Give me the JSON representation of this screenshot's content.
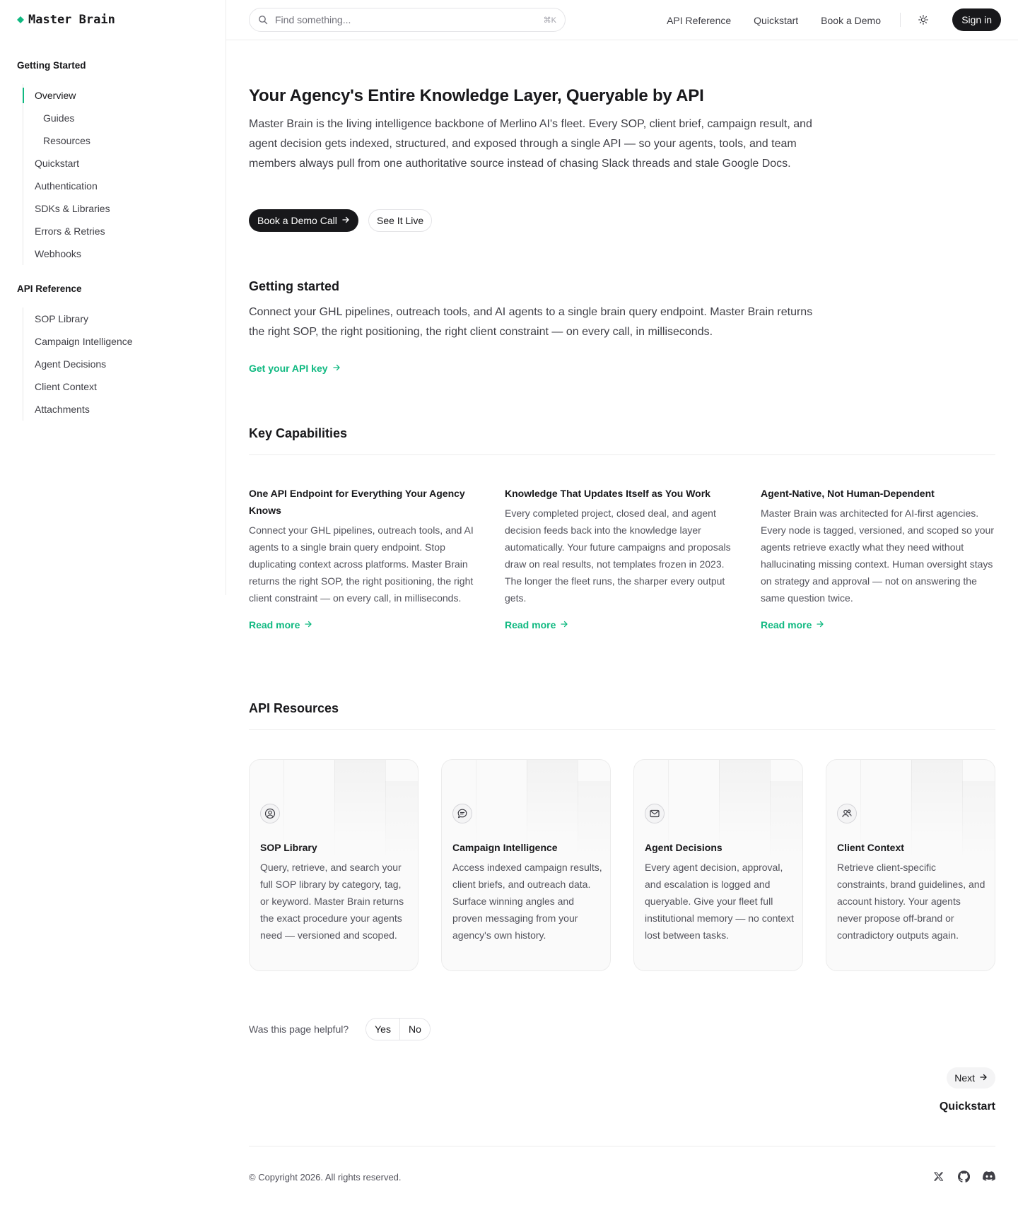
{
  "brand": {
    "name": "Master Brain",
    "accent": "#10b981"
  },
  "sidebar": {
    "groups": [
      {
        "title": "Getting Started",
        "items": [
          {
            "label": "Overview",
            "active": true
          },
          {
            "label": "Guides",
            "sub": true
          },
          {
            "label": "Resources",
            "sub": true
          },
          {
            "label": "Quickstart"
          },
          {
            "label": "Authentication"
          },
          {
            "label": "SDKs & Libraries"
          },
          {
            "label": "Errors & Retries"
          },
          {
            "label": "Webhooks"
          }
        ]
      },
      {
        "title": "API Reference",
        "items": [
          {
            "label": "SOP Library"
          },
          {
            "label": "Campaign Intelligence"
          },
          {
            "label": "Agent Decisions"
          },
          {
            "label": "Client Context"
          },
          {
            "label": "Attachments"
          }
        ]
      }
    ]
  },
  "header": {
    "search_placeholder": "Find something...",
    "search_shortcut": "⌘K",
    "links": [
      "API Reference",
      "Quickstart",
      "Book a Demo"
    ],
    "sign_in": "Sign in"
  },
  "hero": {
    "title": "Your Agency's Entire Knowledge Layer, Queryable by API",
    "description": "Master Brain is the living intelligence backbone of Merlino AI's fleet. Every SOP, client brief, campaign result, and agent decision gets indexed, structured, and exposed through a single API — so your agents, tools, and team members always pull from one authoritative source instead of chasing Slack threads and stale Google Docs.",
    "primary_cta": "Book a Demo Call",
    "secondary_cta": "See It Live"
  },
  "getting_started": {
    "heading": "Getting started",
    "description": "Connect your GHL pipelines, outreach tools, and AI agents to a single brain query endpoint. Master Brain returns the right SOP, the right positioning, the right client constraint — on every call, in milliseconds.",
    "link": "Get your API key"
  },
  "capabilities": {
    "heading": "Key Capabilities",
    "items": [
      {
        "title": "One API Endpoint for Everything Your Agency Knows",
        "body": "Connect your GHL pipelines, outreach tools, and AI agents to a single brain query endpoint. Stop duplicating context across platforms. Master Brain returns the right SOP, the right positioning, the right client constraint — on every call, in milliseconds.",
        "link": "Read more"
      },
      {
        "title": "Knowledge That Updates Itself as You Work",
        "body": "Every completed project, closed deal, and agent decision feeds back into the knowledge layer automatically. Your future campaigns and proposals draw on real results, not templates frozen in 2023. The longer the fleet runs, the sharper every output gets.",
        "link": "Read more"
      },
      {
        "title": "Agent-Native, Not Human-Dependent",
        "body": "Master Brain was architected for AI-first agencies. Every node is tagged, versioned, and scoped so your agents retrieve exactly what they need without hallucinating missing context. Human oversight stays on strategy and approval — not on answering the same question twice.",
        "link": "Read more"
      }
    ]
  },
  "resources": {
    "heading": "API Resources",
    "items": [
      {
        "icon": "user-circle-icon",
        "title": "SOP Library",
        "body": "Query, retrieve, and search your full SOP library by category, tag, or keyword. Master Brain returns the exact procedure your agents need — versioned and scoped."
      },
      {
        "icon": "chat-bubble-icon",
        "title": "Campaign Intelligence",
        "body": "Access indexed campaign results, client briefs, and outreach data. Surface winning angles and proven messaging from your agency's own history."
      },
      {
        "icon": "envelope-icon",
        "title": "Agent Decisions",
        "body": "Every agent decision, approval, and escalation is logged and queryable. Give your fleet full institutional memory — no context lost between tasks."
      },
      {
        "icon": "users-icon",
        "title": "Client Context",
        "body": "Retrieve client-specific constraints, brand guidelines, and account history. Your agents never propose off-brand or contradictory outputs again."
      }
    ]
  },
  "feedback": {
    "label": "Was this page helpful?",
    "yes": "Yes",
    "no": "No"
  },
  "pagination": {
    "next_label": "Next",
    "next_title": "Quickstart"
  },
  "footer": {
    "copyright": "© Copyright 2026. All rights reserved.",
    "socials": [
      "x-icon",
      "github-icon",
      "discord-icon"
    ]
  }
}
